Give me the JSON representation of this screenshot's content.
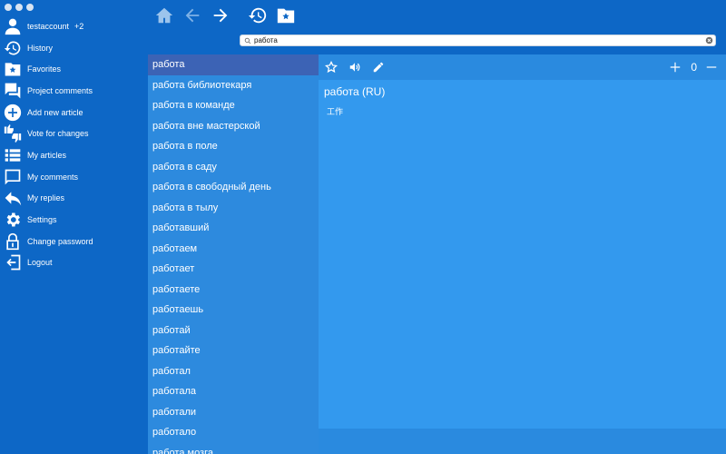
{
  "sidebar": {
    "account": {
      "label": "testaccount",
      "extra": "+2"
    },
    "items": [
      {
        "label": "History"
      },
      {
        "label": "Favorites"
      },
      {
        "label": "Project comments"
      },
      {
        "label": "Add new article"
      },
      {
        "label": "Vote for changes"
      },
      {
        "label": "My articles"
      },
      {
        "label": "My comments"
      },
      {
        "label": "My replies"
      },
      {
        "label": "Settings"
      },
      {
        "label": "Change password"
      },
      {
        "label": "Logout"
      }
    ]
  },
  "search": {
    "value": "работа"
  },
  "word_list": [
    "работа",
    "работа библиотекаря",
    "работа в команде",
    "работа вне мастерской",
    "работа в поле",
    "работа в саду",
    "работа в свободный день",
    "работа в тылу",
    "работавший",
    "работаем",
    "работает",
    "работаете",
    "работаешь",
    "работай",
    "работайте",
    "работал",
    "работала",
    "работали",
    "работало",
    "работа мозга"
  ],
  "detail": {
    "title": "работа (RU)",
    "translation": "工作",
    "vote_count": "0"
  },
  "colors": {
    "sidebar_bg": "#0d67c6",
    "list_bg": "#2d8ade",
    "selected_bg": "#3c63b5",
    "detail_bg": "#3399ee"
  }
}
